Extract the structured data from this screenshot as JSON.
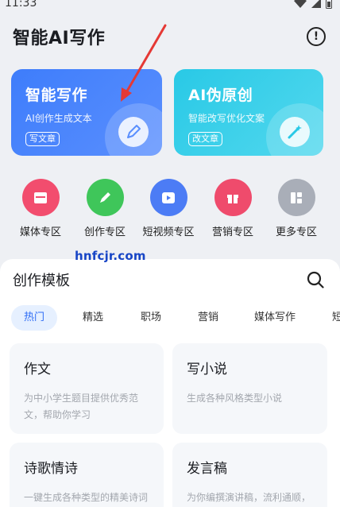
{
  "status": {
    "time": "11:33"
  },
  "header": {
    "title": "智能AI写作"
  },
  "feature_cards": [
    {
      "title": "智能写作",
      "subtitle": "AI创作生成文本",
      "button": "写文章",
      "accent": "#3e7dfb"
    },
    {
      "title": "AI伪原创",
      "subtitle": "智能改写优化文案",
      "button": "改文章",
      "accent": "#29c9e6"
    }
  ],
  "zones": [
    {
      "label": "媒体专区",
      "icon": "media-icon",
      "color": "#f24d6e"
    },
    {
      "label": "创作专区",
      "icon": "pencil-icon",
      "color": "#3fc65a"
    },
    {
      "label": "短视频专区",
      "icon": "video-icon",
      "color": "#4c7cf5"
    },
    {
      "label": "营销专区",
      "icon": "gift-icon",
      "color": "#ef4b6c"
    },
    {
      "label": "更多专区",
      "icon": "grid-icon",
      "color": "#a9aeb8"
    }
  ],
  "watermark": "hnfcjr.com",
  "sheet": {
    "title": "创作模板",
    "tabs": [
      "热门",
      "精选",
      "职场",
      "营销",
      "媒体写作",
      "短"
    ],
    "templates": [
      {
        "title": "作文",
        "desc": "为中小学生题目提供优秀范文，帮助你学习"
      },
      {
        "title": "写小说",
        "desc": "生成各种风格类型小说"
      },
      {
        "title": "诗歌情诗",
        "desc": "一键生成各种类型的精美诗词"
      },
      {
        "title": "发言稿",
        "desc": "为你编撰演讲稿，流利通顺，消除紧张"
      }
    ]
  }
}
